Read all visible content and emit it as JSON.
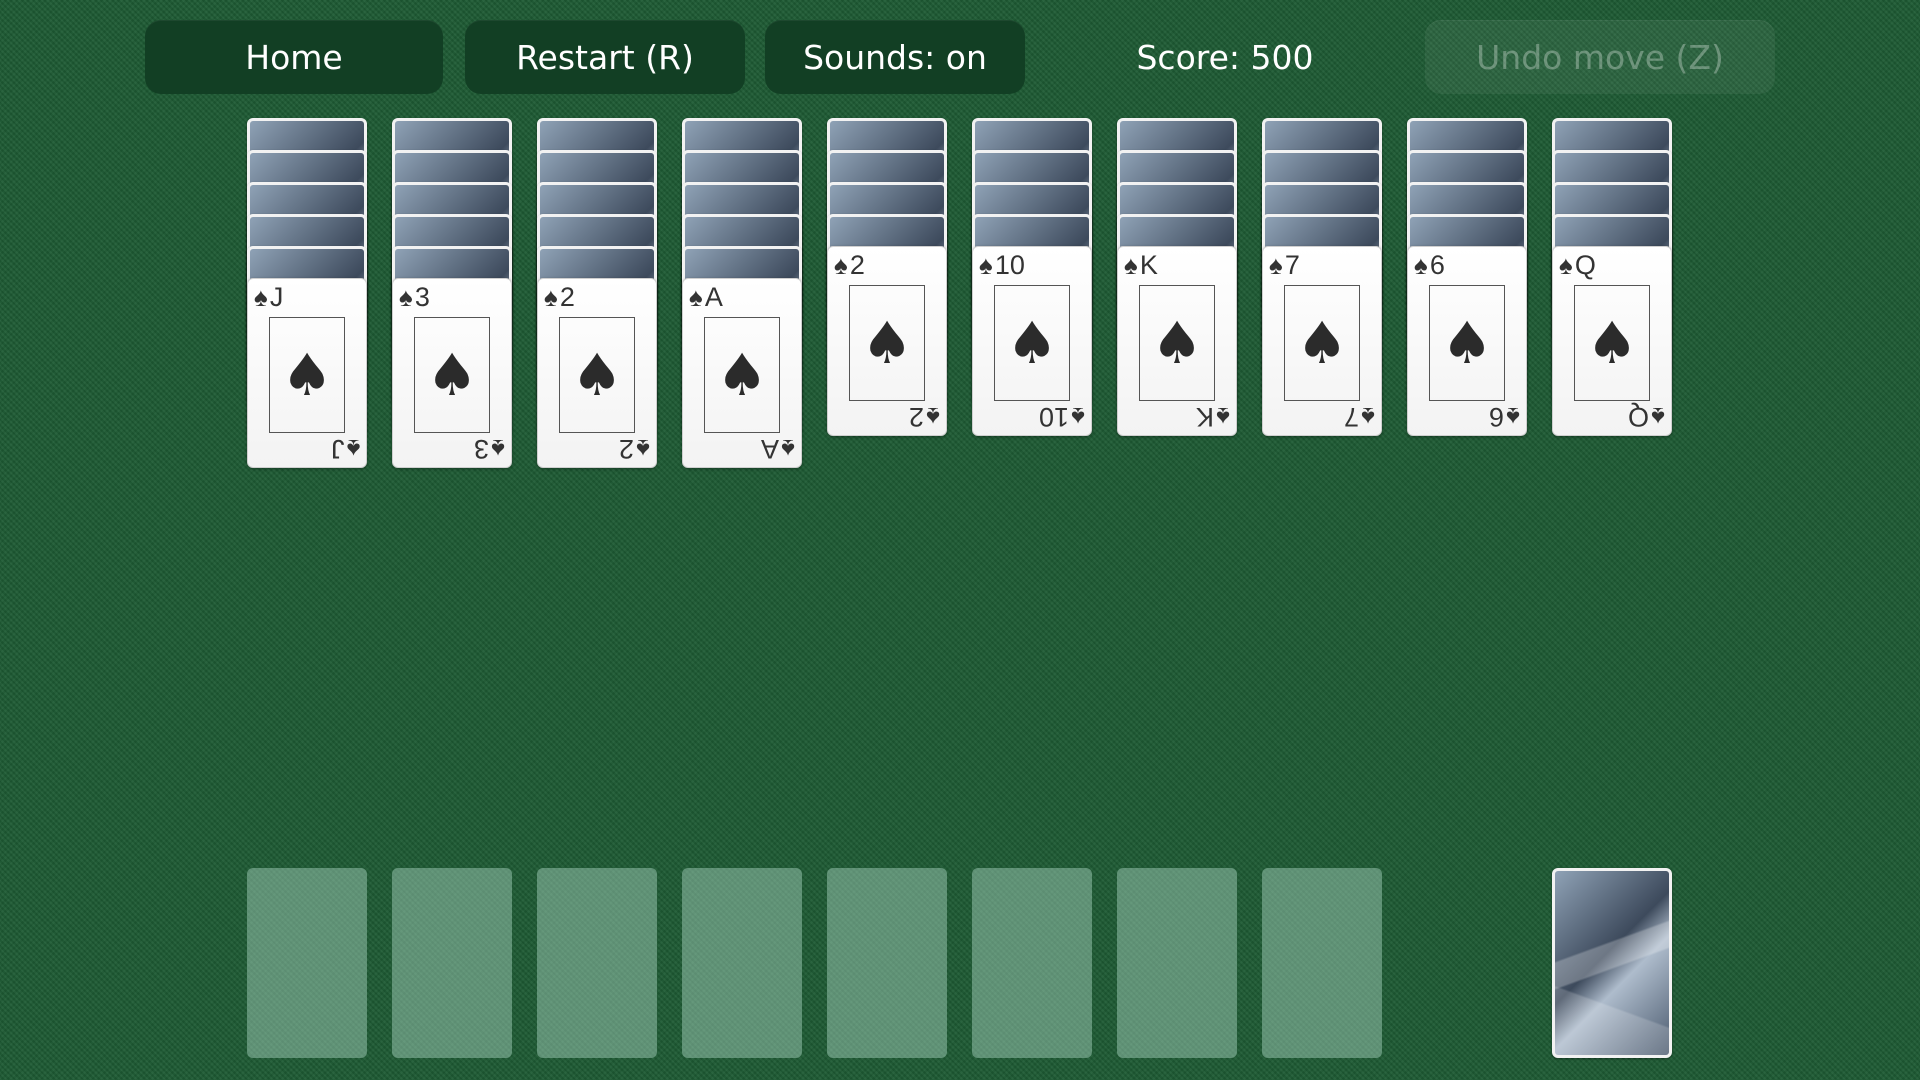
{
  "toolbar": {
    "home_label": "Home",
    "restart_label": "Restart (R)",
    "sounds_label": "Sounds: on",
    "score_label": "Score: 500",
    "undo_label": "Undo move (Z)"
  },
  "suit_symbol": "♠",
  "colors": {
    "felt": "#1d5a33",
    "button": "#123f24",
    "slot": "#8fbcac"
  },
  "tableau": [
    {
      "hidden": 5,
      "top_rank": "J"
    },
    {
      "hidden": 5,
      "top_rank": "3"
    },
    {
      "hidden": 5,
      "top_rank": "2"
    },
    {
      "hidden": 5,
      "top_rank": "A"
    },
    {
      "hidden": 4,
      "top_rank": "2"
    },
    {
      "hidden": 4,
      "top_rank": "10"
    },
    {
      "hidden": 4,
      "top_rank": "K"
    },
    {
      "hidden": 4,
      "top_rank": "7"
    },
    {
      "hidden": 4,
      "top_rank": "6"
    },
    {
      "hidden": 4,
      "top_rank": "Q"
    }
  ],
  "foundation_slots": 8,
  "stock": {
    "present": true
  }
}
